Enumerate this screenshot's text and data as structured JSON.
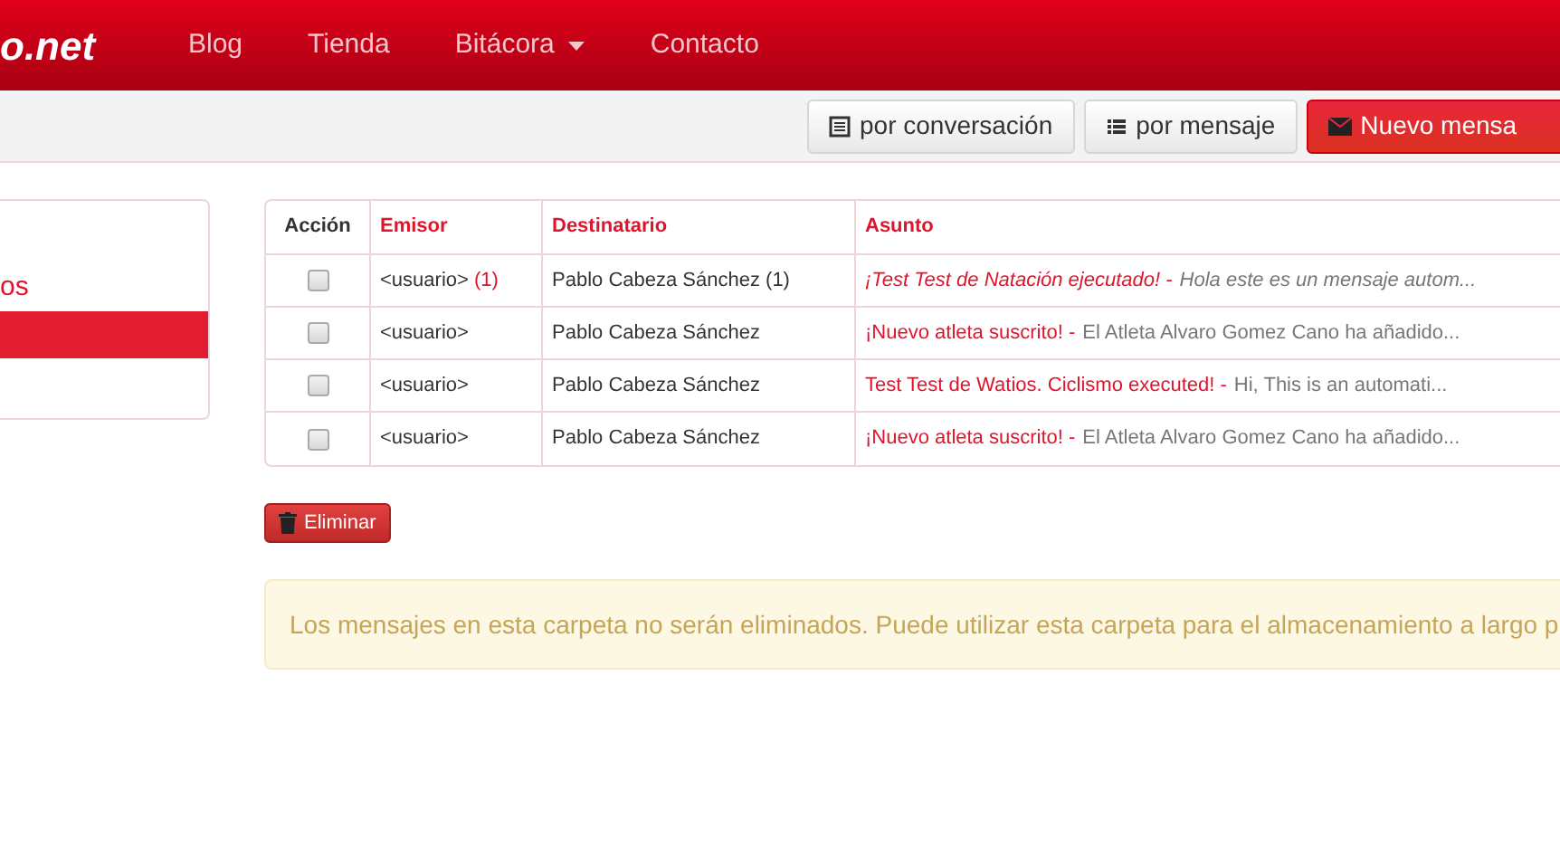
{
  "navbar": {
    "logo": "o.net",
    "links": [
      {
        "label": "Blog",
        "dropdown": false
      },
      {
        "label": "Tienda",
        "dropdown": false
      },
      {
        "label": "Bitácora",
        "dropdown": true
      },
      {
        "label": "Contacto",
        "dropdown": false
      }
    ]
  },
  "toolbar": {
    "buttons": [
      {
        "label": "por conversación",
        "kind": "view"
      },
      {
        "label": "por mensaje",
        "kind": "list"
      },
      {
        "label": "Nuevo mensa",
        "kind": "new"
      }
    ]
  },
  "sidebar": {
    "items": [
      {
        "label": "os",
        "selected": false
      },
      {
        "selected": true
      }
    ]
  },
  "table": {
    "columns": [
      "Acción",
      "Emisor",
      "Destinatario",
      "Asunto"
    ],
    "rows": [
      {
        "checked": false,
        "sender": "<usuario>",
        "sender_count": "(1)",
        "recipient": "Pablo Cabeza Sánchez (1)",
        "subject": "¡Test Test de Natación ejecutado! -",
        "preview": "Hola este es un mensaje autom...",
        "unread": true
      },
      {
        "checked": false,
        "sender": "<usuario>",
        "recipient": "Pablo Cabeza Sánchez",
        "subject": "¡Nuevo atleta suscrito! -",
        "preview": "El Atleta Alvaro Gomez Cano ha añadido...",
        "unread": false
      },
      {
        "checked": false,
        "sender": "<usuario>",
        "recipient": "Pablo Cabeza Sánchez",
        "subject": "Test Test de Watios. Ciclismo executed! -",
        "preview": "Hi, This is an automati...",
        "unread": false
      },
      {
        "checked": false,
        "sender": "<usuario>",
        "recipient": "Pablo Cabeza Sánchez",
        "subject": "¡Nuevo atleta suscrito! -",
        "preview": "El Atleta Alvaro Gomez Cano ha añadido...",
        "unread": false
      }
    ]
  },
  "delete_button": "Eliminar",
  "alert": "Los mensajes en esta carpeta no serán eliminados. Puede utilizar esta carpeta para el almacenamiento a largo p"
}
